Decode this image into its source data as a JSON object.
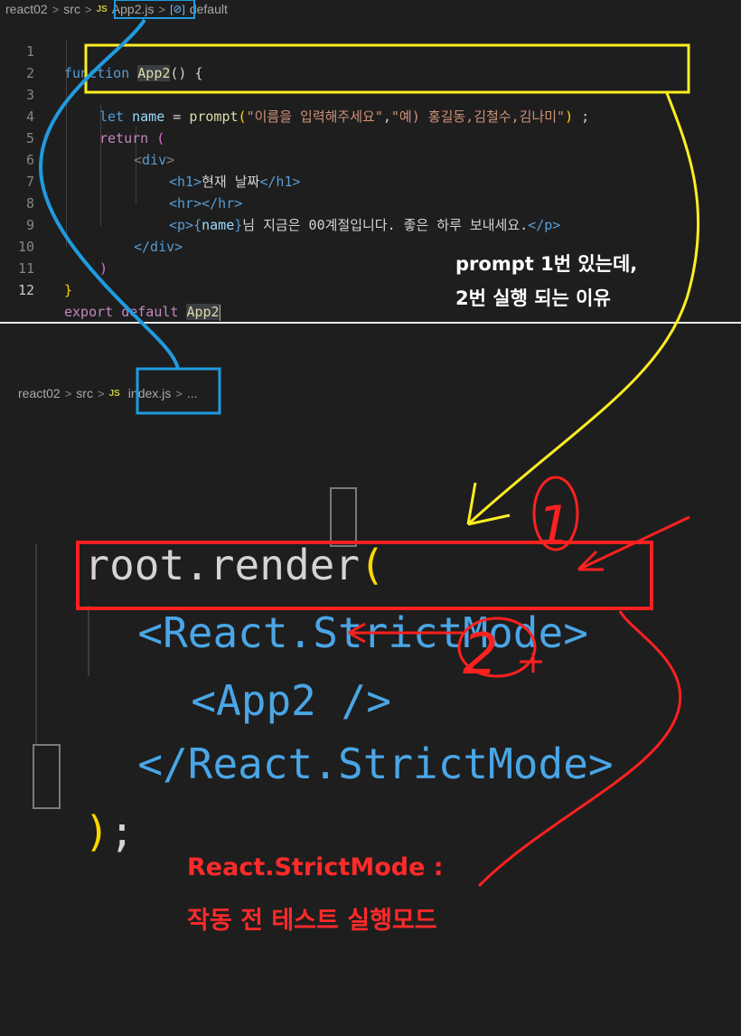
{
  "top_editor": {
    "breadcrumb": {
      "project": "react02",
      "folder": "src",
      "file_badge": "JS",
      "file": "App2.js",
      "symbol_icon": "[⊘]",
      "symbol": "default"
    },
    "lines": [
      {
        "no": "1"
      },
      {
        "no": "2"
      },
      {
        "no": "3"
      },
      {
        "no": "4"
      },
      {
        "no": "5"
      },
      {
        "no": "6"
      },
      {
        "no": "7"
      },
      {
        "no": "8"
      },
      {
        "no": "9"
      },
      {
        "no": "10"
      },
      {
        "no": "11"
      },
      {
        "no": "12"
      }
    ],
    "code": {
      "l1_kw": "function",
      "l1_name": "App2",
      "l1_rest": "() {",
      "l3_kw": "let",
      "l3_var": "name",
      "l3_eq": " = ",
      "l3_fn": "prompt",
      "l3_open": "(",
      "l3_str1": "\"이름을 입력해주세요\"",
      "l3_comma": ",",
      "l3_str2": "\"예) 홍길동,김철수,김나미\"",
      "l3_close": ")",
      "l3_semi": " ;",
      "l4_kw": "return",
      "l4_paren": " (",
      "l5_open": "<",
      "l5_tag": "div",
      "l5_close": ">",
      "l6_tag_open": "<h1>",
      "l6_text": "현재 날짜",
      "l6_tag_close": "</h1>",
      "l7": "<hr></hr>",
      "l8_p_open": "<p>",
      "l8_brace_open": "{",
      "l8_var": "name",
      "l8_brace_close": "}",
      "l8_text": "님 지금은 00계절입니다. 좋은 하루 보내세요.",
      "l8_p_close": "</p>",
      "l9": "</div>",
      "l10": ")",
      "l11": "}",
      "l12_kw": "export default",
      "l12_name": "App2"
    }
  },
  "bottom_editor": {
    "breadcrumb": {
      "project": "react02",
      "folder": "src",
      "file_badge": "JS",
      "file": "index.js",
      "more": "..."
    },
    "code": {
      "root": "root.render",
      "open_paren": "(",
      "strict_open": "<React.StrictMode>",
      "app": "<App2 />",
      "strict_close": "</React.StrictMode>",
      "close_paren": ")",
      "semi": ";"
    }
  },
  "annotations": {
    "question_line1": "prompt 1번 있는데,",
    "question_line2": "2번 실행 되는 이유",
    "mark1": "1",
    "mark2": "2",
    "strict_title": "React.StrictMode :",
    "strict_desc": "작동 전 테스트 실행모드"
  },
  "colors": {
    "keyword": "#569cd6",
    "function": "#dcdcaa",
    "string": "#ce9178",
    "variable": "#9cdcfe",
    "highlight_yellow": "#ffee22",
    "highlight_red": "#ff2020",
    "highlight_blue": "#1f9be0"
  }
}
